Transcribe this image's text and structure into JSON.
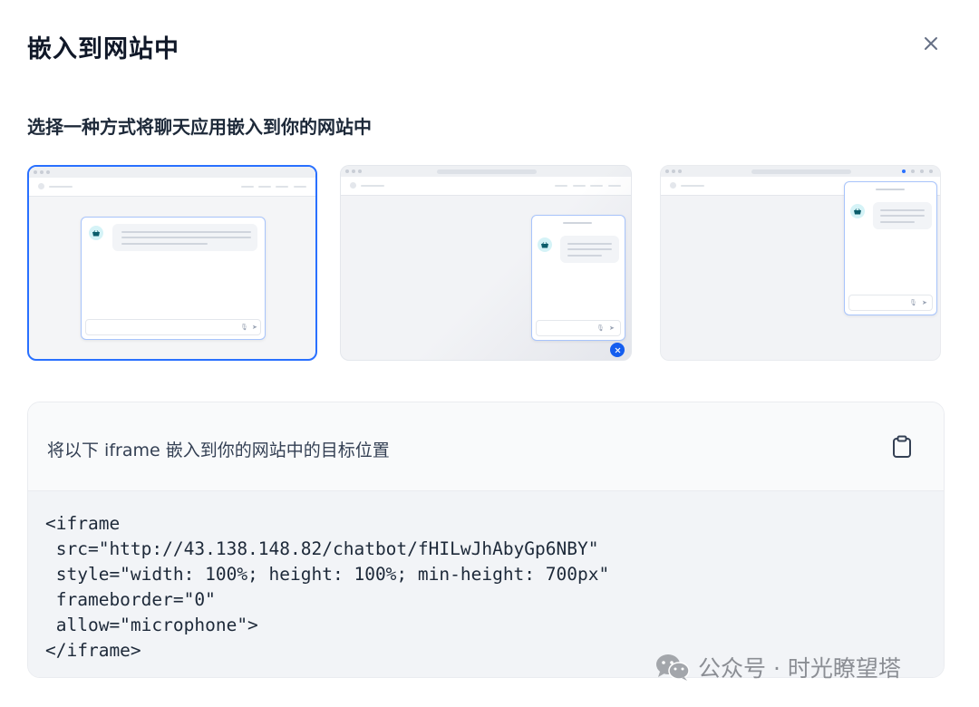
{
  "dialog": {
    "title": "嵌入到网站中",
    "close_icon": "close-icon"
  },
  "options": {
    "heading": "选择一种方式将聊天应用嵌入到你的网站中",
    "selected_index": 0,
    "accent_color": "#2970ff"
  },
  "embed": {
    "instruction": "将以下 iframe 嵌入到你的网站中的目标位置",
    "copy_icon": "clipboard-icon",
    "code_lines": [
      "<iframe",
      " src=\"http://43.138.148.82/chatbot/fHILwJhAbyGp6NBY\"",
      " style=\"width: 100%; height: 100%; min-height: 700px\"",
      " frameborder=\"0\"",
      " allow=\"microphone\">",
      "</iframe>"
    ]
  },
  "watermark": {
    "text": "公众号 · 时光瞭望塔",
    "icon": "wechat-icon"
  }
}
